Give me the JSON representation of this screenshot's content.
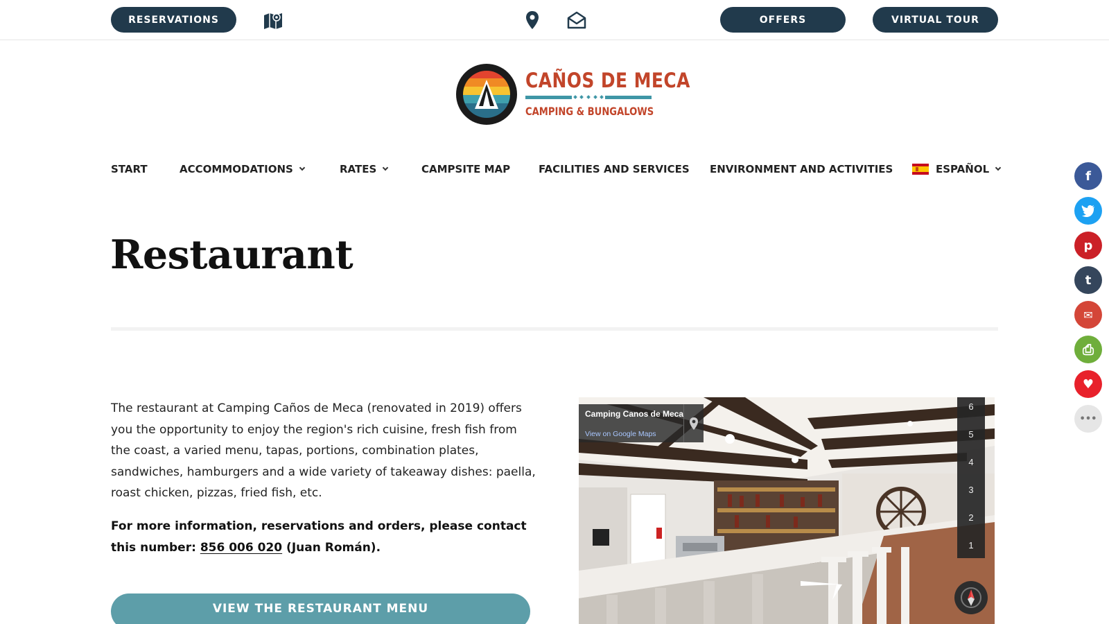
{
  "topbar": {
    "reservations_label": "RESERVATIONS",
    "offers_label": "OFFERS",
    "virtual_tour_label": "VIRTUAL TOUR",
    "icons": [
      "map-icon",
      "location-pin-icon",
      "envelope-icon"
    ],
    "pill_color": "#213a4c"
  },
  "logo": {
    "line1": "CAÑOS DE MECA",
    "line2": "CAMPING & BUNGALOWS",
    "text_color": "#c2452a",
    "accent_color": "#3f96a6"
  },
  "nav": {
    "items": [
      {
        "label": "START"
      },
      {
        "label": "ACCOMMODATIONS"
      },
      {
        "label": "RATES"
      },
      {
        "label": "CAMPSITE MAP"
      },
      {
        "label": "FACILITIES AND SERVICES"
      },
      {
        "label": "ENVIRONMENT AND ACTIVITIES"
      },
      {
        "label": "ESPAÑOL"
      }
    ]
  },
  "page": {
    "title": "Restaurant",
    "paragraph": "The restaurant at Camping Caños de Meca (renovated in 2019) offers you the opportunity to enjoy the region's rich cuisine, fresh fish from the coast, a varied menu, tapas, portions, combination plates, sandwiches, hamburgers and a wide variety of takeaway dishes: paella, roast chicken, pizzas, fried fish, etc.",
    "contact_prefix": "For more information, reservations and orders, please contact this number:",
    "phone": "856 006 020",
    "contact_suffix": "(Juan Román).",
    "menu_button": "VIEW THE RESTAURANT MENU",
    "button_color": "#5d9ea9"
  },
  "streetview": {
    "place_name": "Camping Canos de Meca",
    "maps_link": "View on Google Maps",
    "floors": [
      "6",
      "5",
      "4",
      "3",
      "2",
      "1"
    ]
  },
  "social": [
    {
      "name": "facebook",
      "glyph": "f",
      "color": "#3b5998"
    },
    {
      "name": "twitter",
      "glyph": "t",
      "color": "#1da1f2"
    },
    {
      "name": "pinterest",
      "glyph": "p",
      "color": "#cb2027"
    },
    {
      "name": "tumblr",
      "glyph": "t",
      "color": "#35465c"
    },
    {
      "name": "email",
      "glyph": "✉",
      "color": "#d44638"
    },
    {
      "name": "print",
      "glyph": "⎙",
      "color": "#6fae3b"
    },
    {
      "name": "favorite",
      "glyph": "♥",
      "color": "#e8212b"
    },
    {
      "name": "more",
      "glyph": "•••",
      "color": "#e6e6e6"
    }
  ]
}
